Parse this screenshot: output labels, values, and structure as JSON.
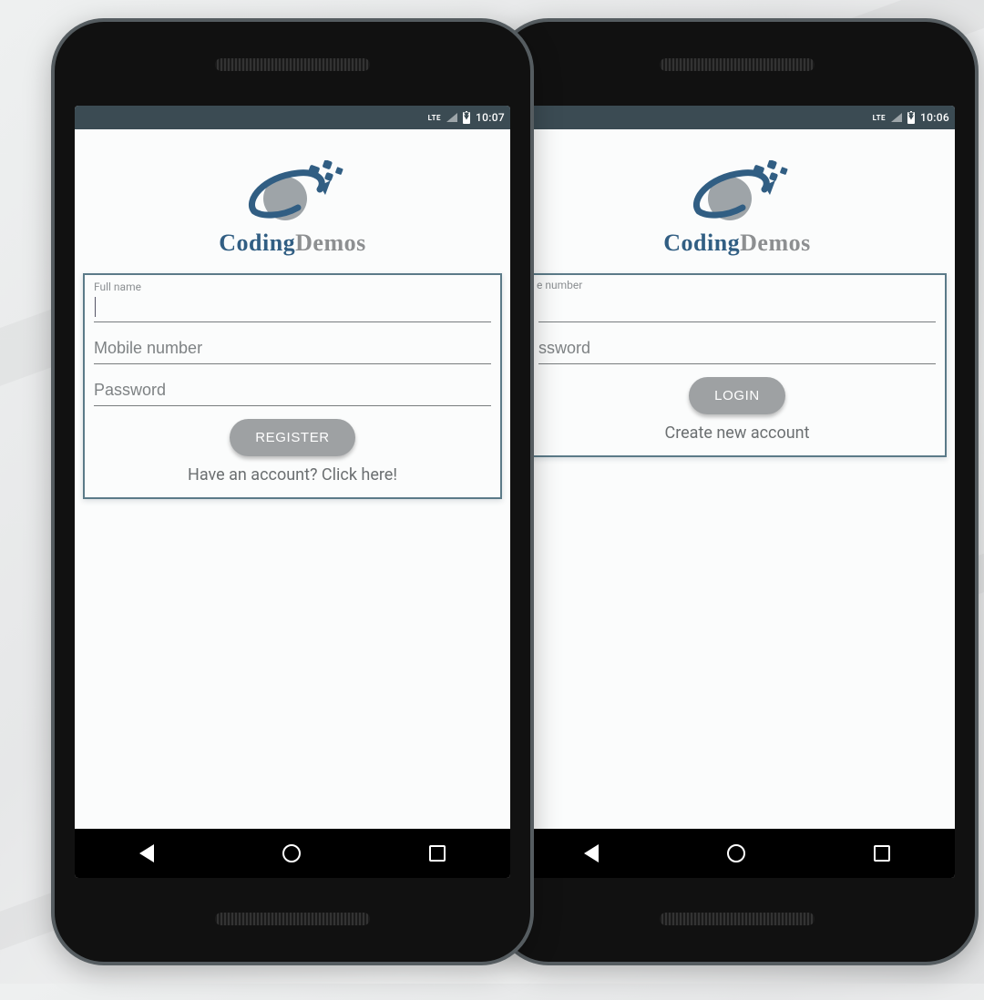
{
  "brand": {
    "part_a": "Coding",
    "part_b": "Demos"
  },
  "phone_left": {
    "status": {
      "lte": "LTE",
      "time": "10:07"
    },
    "form": {
      "field1_label": "Full name",
      "field1_value": "",
      "field2_placeholder": "Mobile number",
      "field3_placeholder": "Password",
      "button": "REGISTER",
      "link": "Have an account? Click here!"
    }
  },
  "phone_right": {
    "status": {
      "lte": "LTE",
      "time": "10:06"
    },
    "form": {
      "field1_label_fragment": "e number",
      "field2_placeholder_fragment": "ssword",
      "button": "LOGIN",
      "link": "Create new account"
    }
  }
}
